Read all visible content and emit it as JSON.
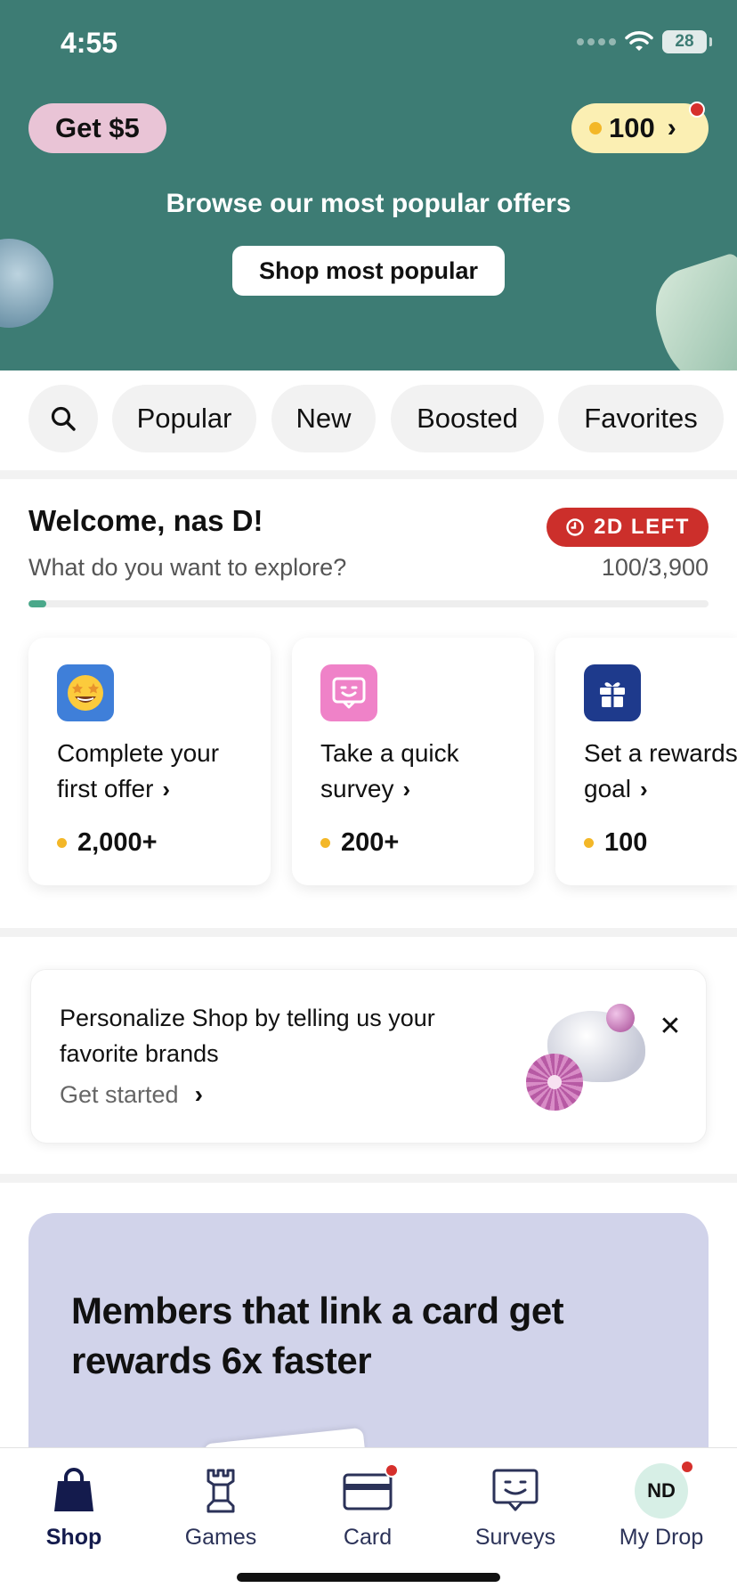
{
  "status_bar": {
    "time": "4:55",
    "battery": "28"
  },
  "header": {
    "get_button": "Get $5",
    "points": "100",
    "points_chevron": "›"
  },
  "hero": {
    "title": "Browse our most popular offers",
    "button": "Shop most popular"
  },
  "filters": [
    "Popular",
    "New",
    "Boosted",
    "Favorites"
  ],
  "welcome": {
    "title": "Welcome, nas D!",
    "timer": "2D LEFT",
    "subtitle": "What do you want to explore?",
    "progress_text": "100/3,900",
    "progress_fraction": 0.026
  },
  "cards": [
    {
      "line1": "Complete your",
      "line2": "first offer",
      "points": "2,000+",
      "icon": "star-struck-emoji-icon",
      "color": "#3f7fd9"
    },
    {
      "line1": "Take a quick",
      "line2": "survey",
      "points": "200+",
      "icon": "smile-chat-icon",
      "color": "#ef82c8"
    },
    {
      "line1": "Set a rewards",
      "line2": "goal",
      "points": "100",
      "icon": "gift-icon",
      "color": "#1e3a8c"
    }
  ],
  "personalize": {
    "text": "Personalize Shop by telling us your favorite brands",
    "link": "Get started"
  },
  "promo": {
    "title": "Members that link a card get rewards 6x faster"
  },
  "tabs": [
    {
      "label": "Shop",
      "icon": "shopping-bag-icon",
      "active": true
    },
    {
      "label": "Games",
      "icon": "chess-rook-icon",
      "active": false
    },
    {
      "label": "Card",
      "icon": "credit-card-icon",
      "active": false
    },
    {
      "label": "Surveys",
      "icon": "survey-chat-icon",
      "active": false
    },
    {
      "label": "My Drop",
      "icon": "avatar",
      "avatar_initials": "ND",
      "active": false
    }
  ],
  "colors": {
    "hero_bg": "#3d7c74",
    "accent_red": "#cc2f2b",
    "coin": "#f3b728",
    "progress": "#4aa88a",
    "tab_active": "#141b4d"
  }
}
